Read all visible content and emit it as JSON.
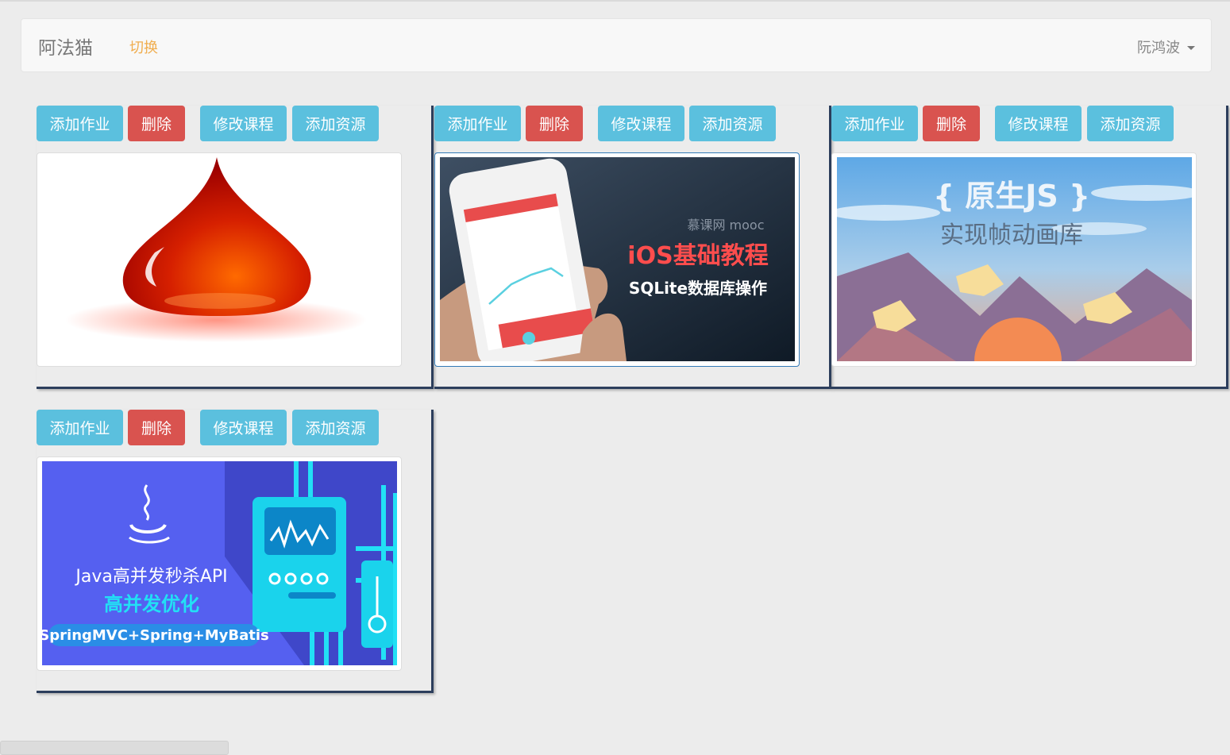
{
  "navbar": {
    "brand": "阿法猫",
    "switch_label": "切换",
    "user_name": "阮鸿波"
  },
  "colors": {
    "info": "#5bc0de",
    "danger": "#d9534f",
    "warning_link": "#f0ad4e",
    "card_border": "#2c3e5c"
  },
  "courses": [
    {
      "image": "red-droplet",
      "buttons": {
        "add_homework": "添加作业",
        "delete": "删除",
        "edit_course": "修改课程",
        "add_resource": "添加资源"
      }
    },
    {
      "image": "ios-sqlite-banner",
      "banner_text": {
        "brand": "慕课网 mooc",
        "title": "iOS基础教程",
        "subtitle": "SQLite数据库操作"
      },
      "buttons": {
        "add_homework": "添加作业",
        "delete": "删除",
        "edit_course": "修改课程",
        "add_resource": "添加资源"
      }
    },
    {
      "image": "native-js-frame-animation-banner",
      "banner_text": {
        "title": "{ 原生JS }",
        "subtitle": "实现帧动画库"
      },
      "buttons": {
        "add_homework": "添加作业",
        "delete": "删除",
        "edit_course": "修改课程",
        "add_resource": "添加资源"
      }
    },
    {
      "image": "java-seckill-banner",
      "banner_text": {
        "title": "Java高并发秒杀API",
        "subtitle": "高并发优化",
        "tag": "SpringMVC+Spring+MyBatis"
      },
      "buttons": {
        "add_homework": "添加作业",
        "delete": "删除",
        "edit_course": "修改课程",
        "add_resource": "添加资源"
      }
    }
  ]
}
